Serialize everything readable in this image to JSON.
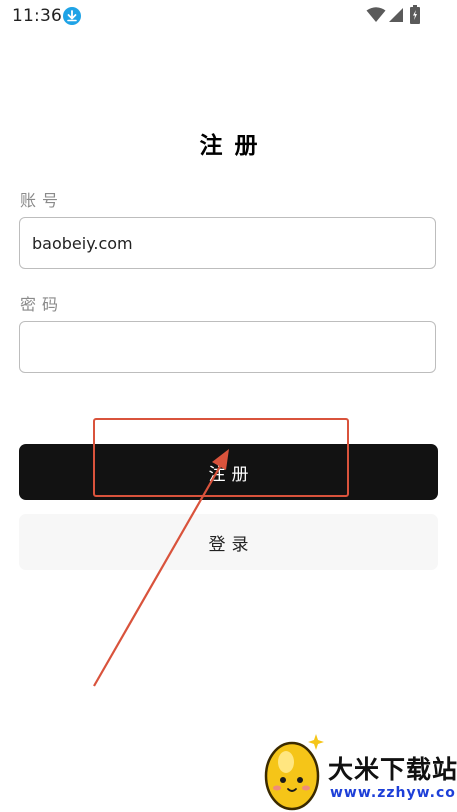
{
  "status_bar": {
    "time": "11:36",
    "download_icon": "download-icon",
    "wifi_icon": "wifi-icon",
    "signal_icon": "signal-icon",
    "battery_icon": "battery-icon"
  },
  "page": {
    "title": "注册"
  },
  "form": {
    "account_label": "账号",
    "account_value": "baobeiy.com",
    "password_label": "密码",
    "password_value": ""
  },
  "buttons": {
    "register_label": "注册",
    "login_label": "登录"
  },
  "watermark": {
    "title": "大米下载站",
    "url": "www.zzhyw.com"
  },
  "colors": {
    "primary_button": "#121212",
    "secondary_button": "#f7f7f7",
    "annotation": "#d9533c",
    "download_badge": "#1fa3e6",
    "watermark_url": "#1d3fd8"
  }
}
